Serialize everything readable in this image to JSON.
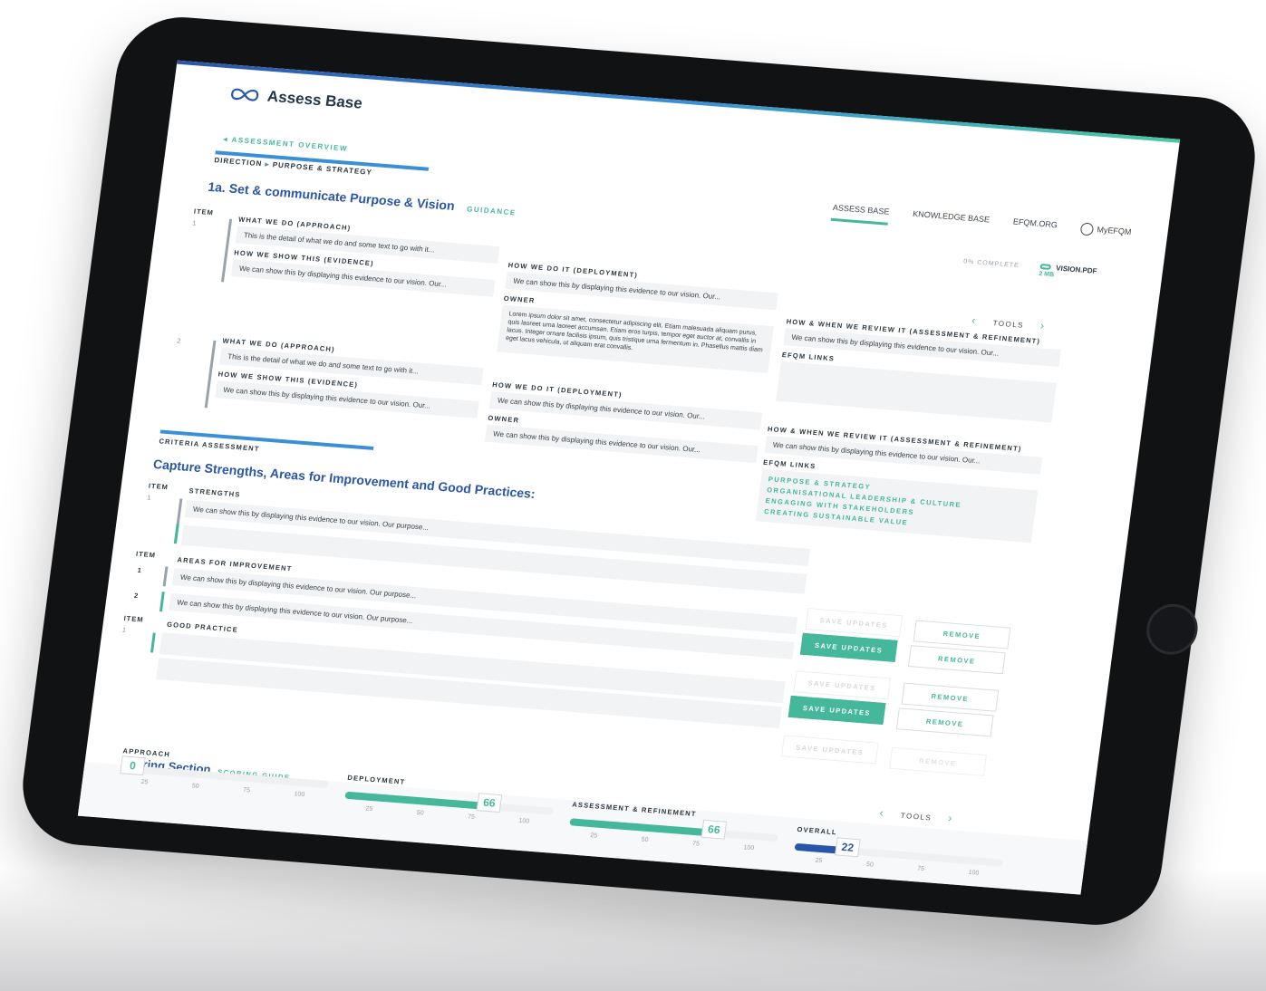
{
  "app": {
    "name": "Assess Base"
  },
  "nav": {
    "items": [
      "ASSESS BASE",
      "KNOWLEDGE BASE",
      "EFQM.ORG"
    ],
    "user": "MyEFQM"
  },
  "back_link": "◂ ASSESSMENT OVERVIEW",
  "breadcrumb": {
    "parent": "DIRECTION",
    "sep": "▸",
    "current": "PURPOSE & STRATEGY"
  },
  "page": {
    "title": "1a. Set & communicate Purpose & Vision",
    "guidance": "GUIDANCE",
    "complete": "0% COMPLETE",
    "attachment": {
      "name": "VISION.PDF",
      "size": "2 MB"
    }
  },
  "items_label": "ITEM",
  "approach_items": [
    {
      "num": "1",
      "approach_label": "WHAT WE DO (APPROACH)",
      "approach_value": "This is the detail of what we do and some text to go with it...",
      "evidence_label": "HOW WE SHOW THIS (EVIDENCE)",
      "evidence_value": "We can show this by displaying this evidence to our vision. Our...",
      "deployment_label": "HOW WE DO IT (DEPLOYMENT)",
      "deployment_value": "We can show this by displaying this evidence to our vision. Our...",
      "owner_label": "OWNER",
      "owner_value": "Lorem ipsum dolor sit amet, consectetur adipiscing elit. Etiam malesuada aliquam purus, quis laoreet urna laoreet accumsan. Etiam eros turpis, tempor eget auctor at, convallis in lacus. Integer ornare facilisis ipsum, quis tristique urna fermentum in. Phasellus mattis diam eget lacus vehicula, ut aliquam erat convallis.",
      "review_label": "HOW & WHEN WE REVIEW IT (ASSESSMENT & REFINEMENT)",
      "review_value": "We can show this by displaying this evidence to our vision. Our...",
      "links_label": "EFQM LINKS",
      "links": []
    },
    {
      "num": "2",
      "approach_label": "WHAT WE DO (APPROACH)",
      "approach_value": "This is the detail of what we do and some text to go with it...",
      "evidence_label": "HOW WE SHOW THIS (EVIDENCE)",
      "evidence_value": "We can show this by displaying this evidence to our vision. Our...",
      "deployment_label": "HOW WE DO IT (DEPLOYMENT)",
      "deployment_value": "We can show this by displaying this evidence to our vision. Our...",
      "owner_label": "OWNER",
      "owner_value": "We can show this by displaying this evidence to our vision. Our...",
      "review_label": "HOW & WHEN WE REVIEW IT (ASSESSMENT & REFINEMENT)",
      "review_value": "We can show this by displaying this evidence to our vision. Our...",
      "links_label": "EFQM LINKS",
      "links": [
        "PURPOSE & STRATEGY",
        "ORGANISATIONAL LEADERSHIP & CULTURE",
        "ENGAGING WITH STAKEHOLDERS",
        "CREATING SUSTAINABLE VALUE"
      ]
    }
  ],
  "tools": "TOOLS",
  "criteria": {
    "section_label": "CRITERIA ASSESSMENT",
    "heading": "Capture Strengths, Areas for Improvement and Good Practices:",
    "strengths": {
      "label": "STRENGTHS",
      "rows": [
        {
          "num": "1",
          "value": "We can show this by displaying this evidence to our vision. Our purpose..."
        }
      ]
    },
    "improvement": {
      "label": "AREAS FOR IMPROVEMENT",
      "rows": [
        {
          "num": "1",
          "value": "We can show this by displaying this evidence to our vision. Our purpose..."
        },
        {
          "num": "2",
          "value": "We can show this by displaying this evidence to our vision. Our purpose..."
        }
      ]
    },
    "good_practice": {
      "label": "GOOD PRACTICE",
      "rows": [
        {
          "num": "1",
          "value": ""
        }
      ]
    },
    "save_label": "SAVE UPDATES",
    "remove_label": "REMOVE"
  },
  "scoring": {
    "title": "Scoring Section",
    "guide": "SCORING GUIDE",
    "ticks": [
      "25",
      "50",
      "75",
      "100"
    ],
    "groups": [
      {
        "label": "APPROACH",
        "value": 0,
        "accent": "#45b79b"
      },
      {
        "label": "DEPLOYMENT",
        "value": 66,
        "accent": "#45b79b"
      },
      {
        "label": "ASSESSMENT & REFINEMENT",
        "value": 66,
        "accent": "#45b79b"
      },
      {
        "label": "OVERALL",
        "value": 22,
        "accent": "#2a55a8"
      }
    ]
  },
  "colors": {
    "brand_blue": "#2a55a8",
    "accent_teal": "#45b79b",
    "device": "#111214"
  }
}
